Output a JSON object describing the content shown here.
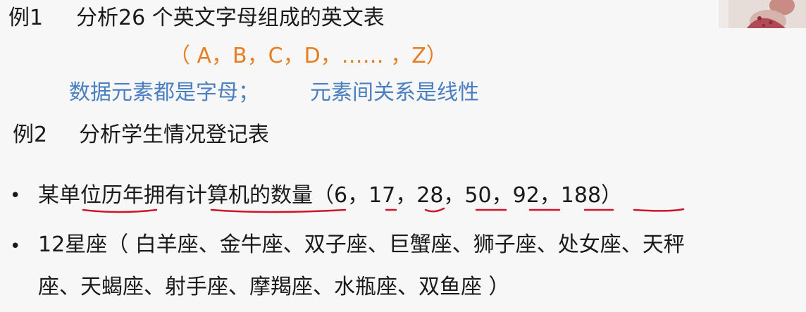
{
  "example1": {
    "label": "例1",
    "text": "分析26 个英文字母组成的英文表",
    "alphabet": "（ A，B，C，D，……  ，Z）",
    "note_elements": "数据元素都是字母；",
    "note_relation": "元素间关系是线性"
  },
  "example2": {
    "label": "例2",
    "text": "分析学生情况登记表"
  },
  "bullets": [
    {
      "marker": "•",
      "text": "某单位历年拥有计算机的数量（6，17，28，50，92，188）"
    },
    {
      "marker": "•",
      "line1": "12星座（ 白羊座、金牛座、双子座、巨蟹座、狮子座、处女座、天秤",
      "line2": "座、天蝎座、射手座、摩羯座、水瓶座、双鱼座 ）"
    }
  ],
  "colors": {
    "accent_orange": "#e67e22",
    "accent_blue": "#4a7fc1",
    "annotation_red": "#d0152a"
  }
}
